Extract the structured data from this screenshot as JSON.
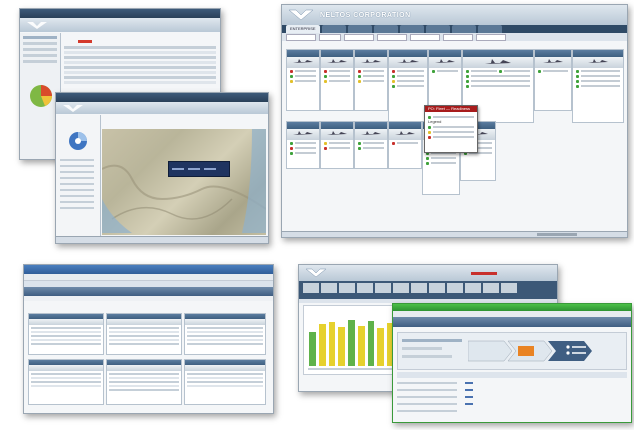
{
  "screenshots": {
    "top_right": {
      "brand": "NELTOS CORPORATION",
      "tab_label": "ENTERPRISE",
      "popup_title": "PO: Fleet — Readiness",
      "popup_legend": "Legend"
    },
    "top_left_map": {
      "map_overlay_label": "Fleet Locations"
    },
    "bottom_right": {
      "chart_tab": "Overview"
    }
  },
  "colors": {
    "accent": "#3e5f80",
    "status_red": "#c8302c",
    "status_green": "#3ea23a",
    "status_yellow": "#e2c02a",
    "bar_yellow": "#e6d12e",
    "bar_green": "#5fb24a",
    "select_green": "#2fa43a"
  }
}
